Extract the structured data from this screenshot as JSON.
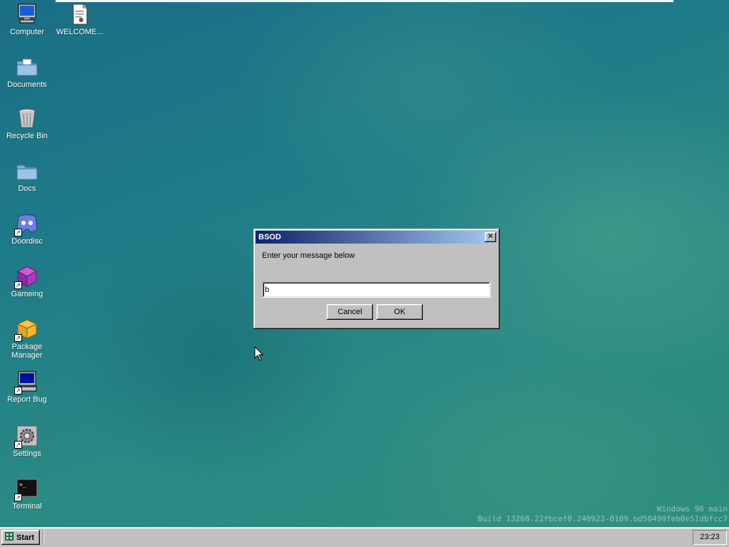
{
  "desktop": {
    "icons": [
      {
        "label": "Computer",
        "icon": "computer-icon"
      },
      {
        "label": "WELCOME...",
        "icon": "document-icon"
      },
      {
        "label": "Documents",
        "icon": "documents-folder-icon"
      },
      {
        "label": "Recycle Bin",
        "icon": "recycle-bin-icon"
      },
      {
        "label": "Docs",
        "icon": "folder-icon"
      },
      {
        "label": "Doordisc",
        "icon": "chat-app-icon"
      },
      {
        "label": "Gameing",
        "icon": "cube-icon"
      },
      {
        "label": "Package Manager",
        "icon": "package-icon"
      },
      {
        "label": "Report Bug",
        "icon": "monitor-icon"
      },
      {
        "label": "Settings",
        "icon": "gear-icon"
      },
      {
        "label": "Terminal",
        "icon": "terminal-icon"
      }
    ],
    "watermark": {
      "line1": "Windows 96 main",
      "line2": "Build 13268.22fbcef0.240923-0109.bd50499feb0e51dbfcc7"
    }
  },
  "dialog": {
    "title": "BSOD",
    "prompt": "Enter your message below",
    "input_value": "b",
    "cancel_label": "Cancel",
    "ok_label": "OK",
    "close_glyph": "✕"
  },
  "taskbar": {
    "start_label": "Start",
    "clock": "23:23"
  },
  "colors": {
    "titlebar_start": "#0a246a",
    "titlebar_end": "#a6caf0",
    "window_face": "#c0c0c0"
  }
}
